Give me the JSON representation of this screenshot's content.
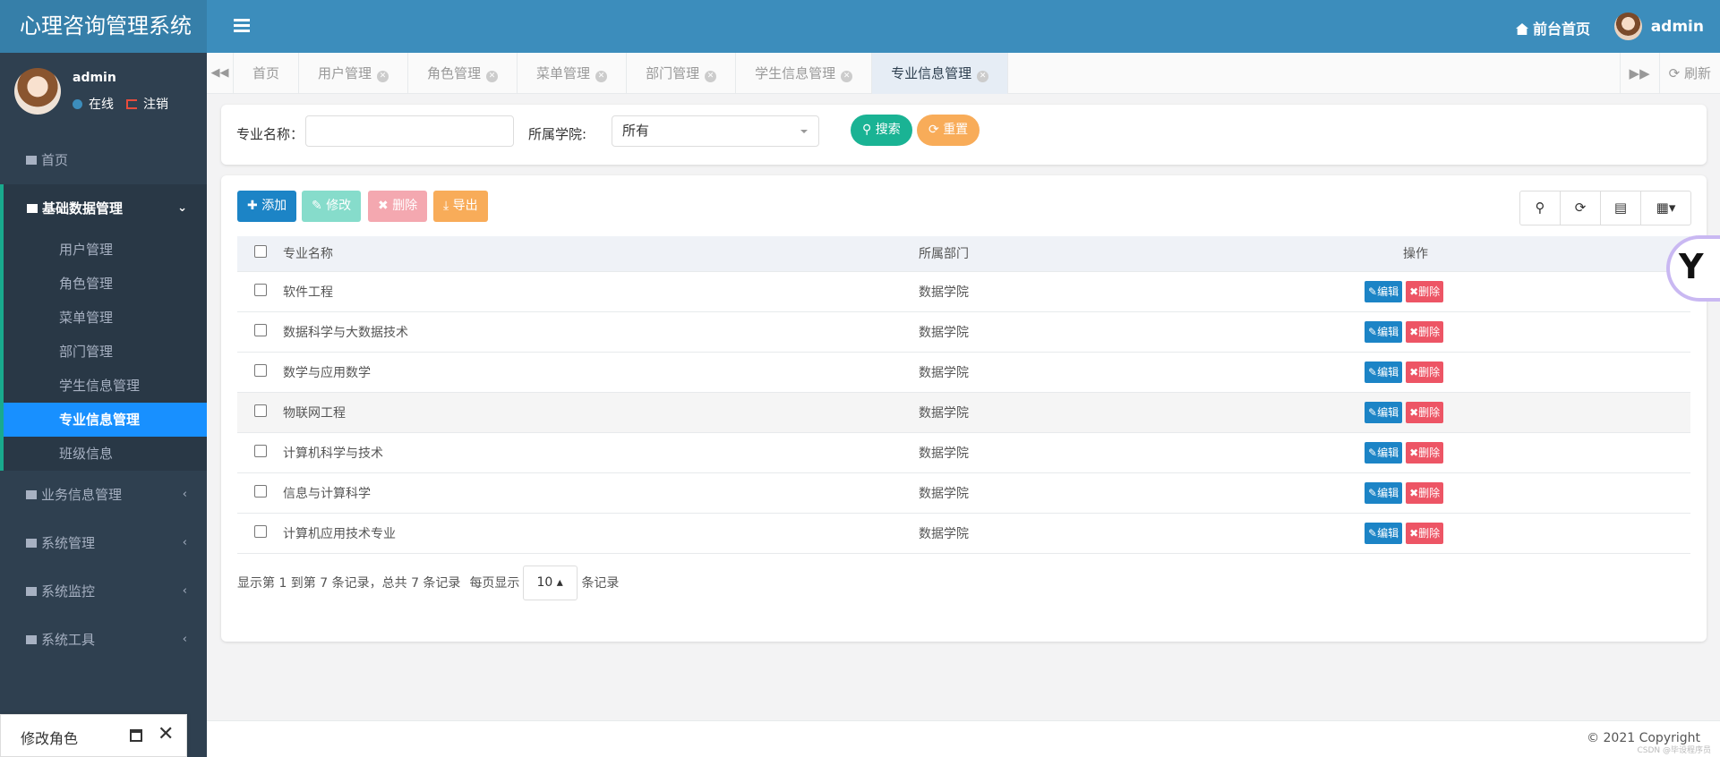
{
  "app": {
    "title": "心理咨询管理系统",
    "menu_toggle_icon": "hamburger-icon"
  },
  "header": {
    "front_link": "前台首页",
    "user": "admin"
  },
  "user_panel": {
    "name": "admin",
    "status": "在线",
    "logout": "注销"
  },
  "sidebar": {
    "home": "首页",
    "open_menu": {
      "label": "基础数据管理",
      "items": [
        "用户管理",
        "角色管理",
        "菜单管理",
        "部门管理",
        "学生信息管理",
        "专业信息管理",
        "班级信息"
      ],
      "active": "专业信息管理"
    },
    "menus": [
      "业务信息管理",
      "系统管理",
      "系统监控",
      "系统工具"
    ]
  },
  "tabs": {
    "items": [
      "首页",
      "用户管理",
      "角色管理",
      "菜单管理",
      "部门管理",
      "学生信息管理",
      "专业信息管理"
    ],
    "active": "专业信息管理",
    "refresh": "刷新"
  },
  "search": {
    "major_label": "专业名称：",
    "major_value": "",
    "college_label": "所属学院:",
    "college_value": "所有",
    "search_btn": "搜索",
    "reset_btn": "重置"
  },
  "toolbar": {
    "add": "添加",
    "edit": "修改",
    "delete": "删除",
    "export": "导出"
  },
  "table": {
    "headers": {
      "name": "专业名称",
      "dept": "所属部门",
      "op": "操作"
    },
    "rows": [
      {
        "name": "软件工程",
        "dept": "数据学院"
      },
      {
        "name": "数据科学与大数据技术",
        "dept": "数据学院"
      },
      {
        "name": "数学与应用数学",
        "dept": "数据学院"
      },
      {
        "name": "物联网工程",
        "dept": "数据学院"
      },
      {
        "name": "计算机科学与技术",
        "dept": "数据学院"
      },
      {
        "name": "信息与计算科学",
        "dept": "数据学院"
      },
      {
        "name": "计算机应用技术专业",
        "dept": "数据学院"
      }
    ],
    "row_edit": "编辑",
    "row_delete": "删除"
  },
  "pager": {
    "summary": "显示第 1 到第 7 条记录，总共 7 条记录",
    "per_page_prefix": "每页显示",
    "page_size": "10",
    "per_page_suffix": "条记录"
  },
  "footer": {
    "copyright": "© 2021 Copyright",
    "watermark": "CSDN @毕设程序员"
  },
  "mini_dialog": {
    "title": "修改角色"
  },
  "colors": {
    "header": "#3c8dbc",
    "sidebar": "#2f4050",
    "active": "#1890ff",
    "primary": "#1c84c6",
    "success": "#1ab394",
    "warning": "#f8ac59",
    "danger": "#ed5565"
  }
}
